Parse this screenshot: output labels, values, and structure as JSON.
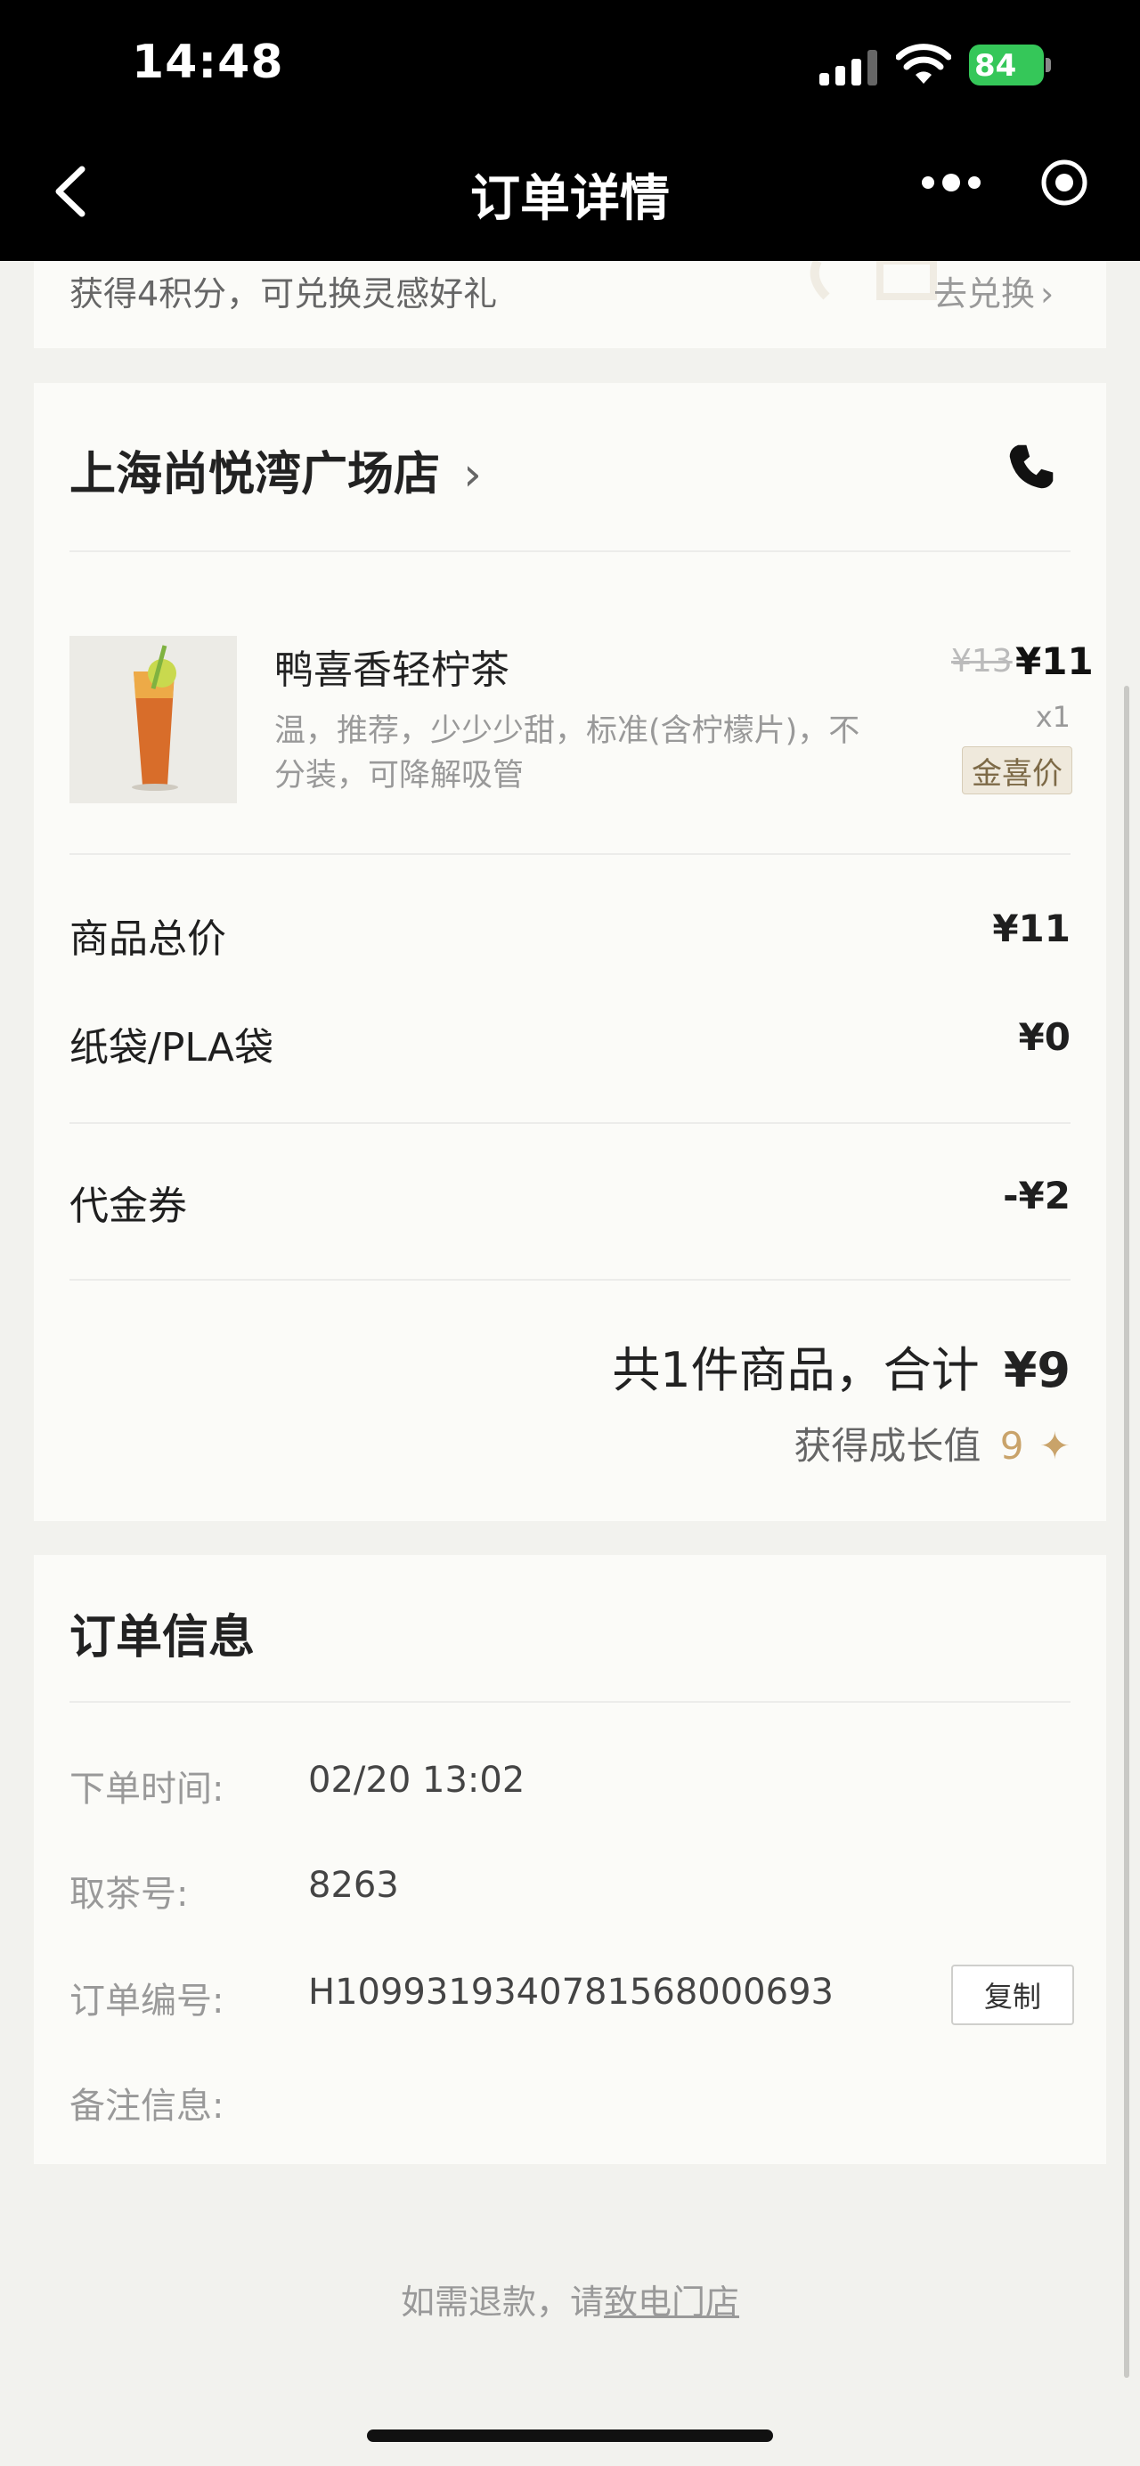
{
  "status_bar": {
    "time": "14:48",
    "battery": "84"
  },
  "nav": {
    "title": "订单详情"
  },
  "points_banner": {
    "text": "获得4积分，可兑换灵感好礼",
    "action": "去兑换"
  },
  "store": {
    "name": "上海尚悦湾广场店"
  },
  "product": {
    "name": "鸭喜香轻柠茶",
    "options": [
      "温，推荐，少少少甜，标准(含柠檬片)，不",
      "分装，可降解吸管"
    ],
    "original_price": "¥13",
    "price": "¥11",
    "quantity": "x1",
    "tag": "金喜价"
  },
  "summary": {
    "rows": [
      {
        "label": "商品总价",
        "value": "¥11"
      },
      {
        "label": "纸袋/PLA袋",
        "value": "¥0"
      },
      {
        "label": "代金券",
        "value": "-¥2"
      }
    ],
    "total_text": "共1件商品，合计",
    "total_value": "¥9",
    "growth_label": "获得成长值",
    "growth_value": "9"
  },
  "order_info": {
    "title": "订单信息",
    "rows": [
      {
        "label": "下单时间:",
        "value": "02/20 13:02"
      },
      {
        "label": "取茶号:",
        "value": "8263"
      },
      {
        "label": "订单编号:",
        "value": "H1099319340781568000693"
      },
      {
        "label": "备注信息:",
        "value": ""
      }
    ],
    "copy_label": "复制"
  },
  "refund": {
    "prefix": "如需退款，请",
    "link": "致电门店"
  },
  "colors": {
    "accent_gold": "#c9a36a",
    "battery_green": "#35c759",
    "header_bg": "#000000"
  }
}
